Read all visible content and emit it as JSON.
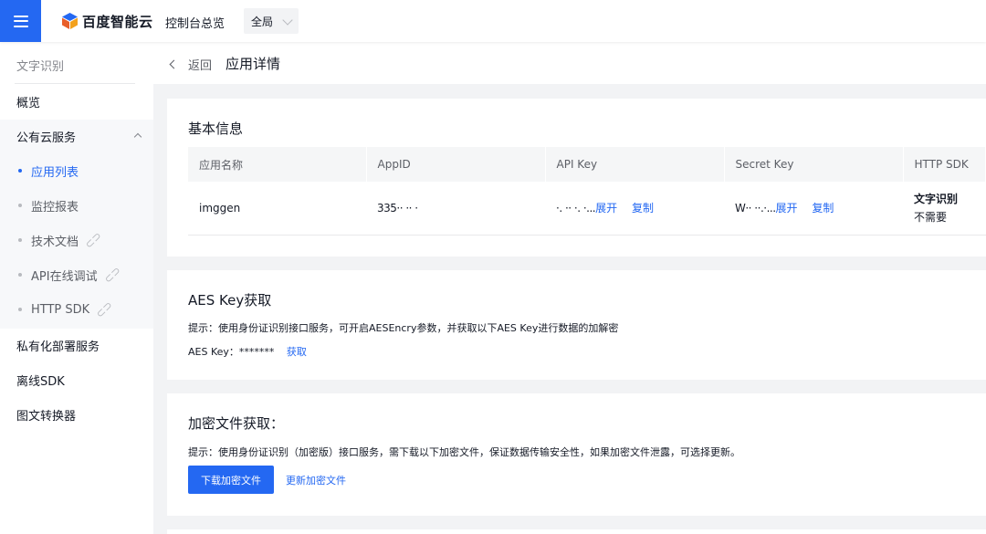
{
  "topbar": {
    "brand": "百度智能云",
    "overview": "控制台总览",
    "region": "全局"
  },
  "sidebar": {
    "title": "文字识别",
    "items": [
      {
        "label": "概览"
      },
      {
        "label": "公有云服务"
      },
      {
        "label": "应用列表"
      },
      {
        "label": "监控报表"
      },
      {
        "label": "技术文档"
      },
      {
        "label": "API在线调试"
      },
      {
        "label": "HTTP SDK"
      },
      {
        "label": "私有化部署服务"
      },
      {
        "label": "离线SDK"
      },
      {
        "label": "图文转换器"
      }
    ]
  },
  "header": {
    "back": "返回",
    "title": "应用详情"
  },
  "basic": {
    "title": "基本信息",
    "columns": [
      "应用名称",
      "AppID",
      "API Key",
      "Secret Key",
      "HTTP SDK"
    ],
    "row": {
      "name": "imggen",
      "appid": "335·· ·· ·",
      "apikey": "·. ·· ·. ·...",
      "secretkey": "W·· ··.·...",
      "expand": "展开",
      "copy": "复制",
      "sdk_name": "文字识别",
      "sdk_value": "不需要"
    }
  },
  "aes": {
    "title": "AES Key获取",
    "hint": "提示：使用身份证识别接口服务，可开启AESEncry参数，并获取以下AES Key进行数据的加解密",
    "label": "AES Key：*******",
    "action": "获取"
  },
  "encrypt": {
    "title": "加密文件获取：",
    "hint": "提示：使用身份证识别（加密版）接口服务，需下载以下加密文件，保证数据传输安全性，如果加密文件泄露，可选择更新。",
    "download": "下载加密文件",
    "update": "更新加密文件"
  },
  "colors": {
    "primary": "#2468f2",
    "text": "#151a26",
    "muted": "#84868c",
    "bg": "#f2f3f5"
  }
}
